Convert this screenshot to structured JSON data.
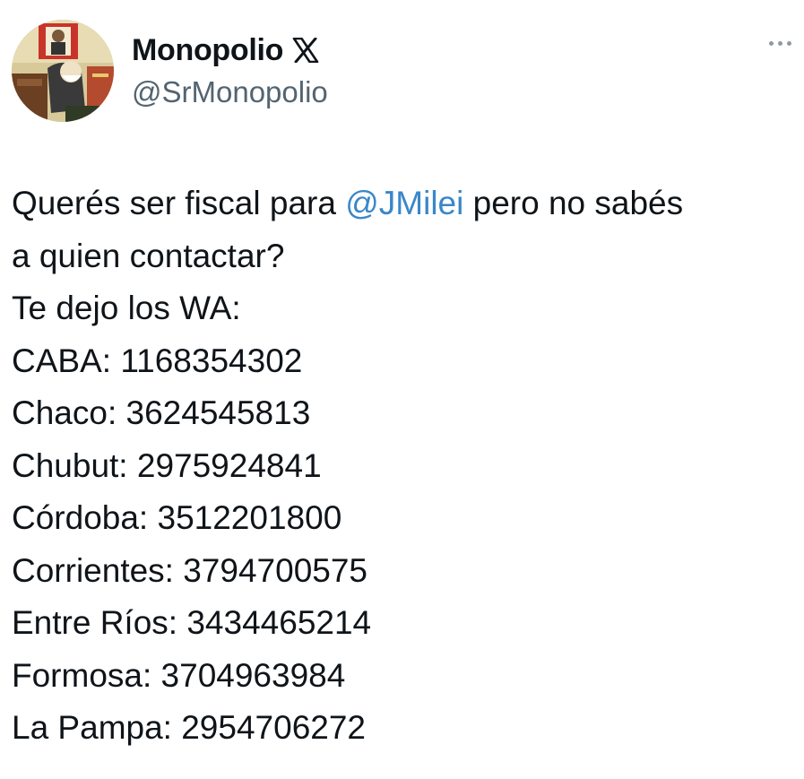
{
  "user": {
    "display_name": "Monopolio",
    "platform_icon": "x-logo-icon",
    "handle": "@SrMonopolio",
    "avatar_icon": "avatar-cartoon"
  },
  "menu": {
    "icon": "more-dots-icon"
  },
  "tweet": {
    "intro_before": "Querés ser fiscal para ",
    "mention": "@JMilei",
    "intro_after": " pero no sabés",
    "line2": "a quien contactar?",
    "line3": "Te dejo los WA:",
    "contacts": [
      "CABA: 1168354302",
      "Chaco: 3624545813",
      "Chubut: 2975924841",
      "Córdoba: 3512201800",
      "Corrientes: 3794700575",
      "Entre Ríos: 3434465214",
      "Formosa: 3704963984",
      "La Pampa: 2954706272"
    ]
  },
  "colors": {
    "text": "#0f1419",
    "secondary": "#536471",
    "link": "#3a87c9"
  }
}
